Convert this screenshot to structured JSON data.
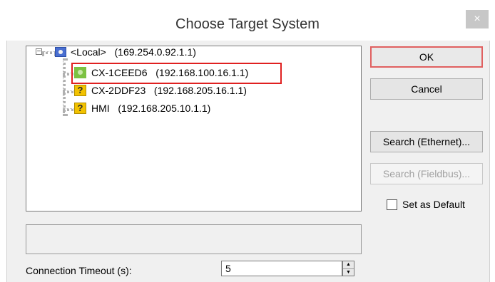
{
  "dialog": {
    "title": "Choose Target System",
    "close_glyph": "×"
  },
  "tree": {
    "expander_glyph": "−",
    "nodes": [
      {
        "name": "<Local>",
        "address": "(169.254.0.92.1.1)",
        "icon": "local-computer-icon"
      },
      {
        "name": "CX-1CEED6",
        "address": "(192.168.100.16.1.1)",
        "icon": "green-target-icon"
      },
      {
        "name": "CX-2DDF23",
        "address": "(192.168.205.16.1.1)",
        "icon": "unknown-target-icon"
      },
      {
        "name": "HMI",
        "address": "(192.168.205.10.1.1)",
        "icon": "unknown-target-icon"
      }
    ],
    "unknown_glyph": "?"
  },
  "buttons": {
    "ok": "OK",
    "cancel": "Cancel",
    "search_ethernet": "Search (Ethernet)...",
    "search_fieldbus": "Search (Fieldbus)..."
  },
  "set_default": {
    "label": "Set as Default",
    "checked": false
  },
  "timeout": {
    "label": "Connection Timeout (s):",
    "value": "5"
  },
  "colors": {
    "highlight": "#e02020",
    "ok_border": "#e06060"
  }
}
